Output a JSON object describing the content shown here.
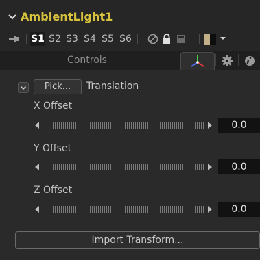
{
  "node": {
    "title": "AmbientLight1",
    "title_color": "#d6c23c"
  },
  "versions": {
    "slots": [
      "S1",
      "S2",
      "S3",
      "S4",
      "S5",
      "S6"
    ],
    "active": "S1"
  },
  "tabs": {
    "controls_label": "Controls",
    "active_tab": "3d-transform-icon"
  },
  "transform_group": {
    "pick_label": "Pick...",
    "group_label": "Translation"
  },
  "params": [
    {
      "label": "X Offset",
      "value": "0.0"
    },
    {
      "label": "Y Offset",
      "value": "0.0"
    },
    {
      "label": "Z Offset",
      "value": "0.0"
    }
  ],
  "import_label": "Import Transform...",
  "icons": [
    "chevron-down-icon",
    "pin-icon",
    "disable-icon",
    "lock-icon",
    "save-icon",
    "color-swatch-icon",
    "dropdown-arrow-icon",
    "3d-axis-icon",
    "gear-icon",
    "info-icon"
  ]
}
